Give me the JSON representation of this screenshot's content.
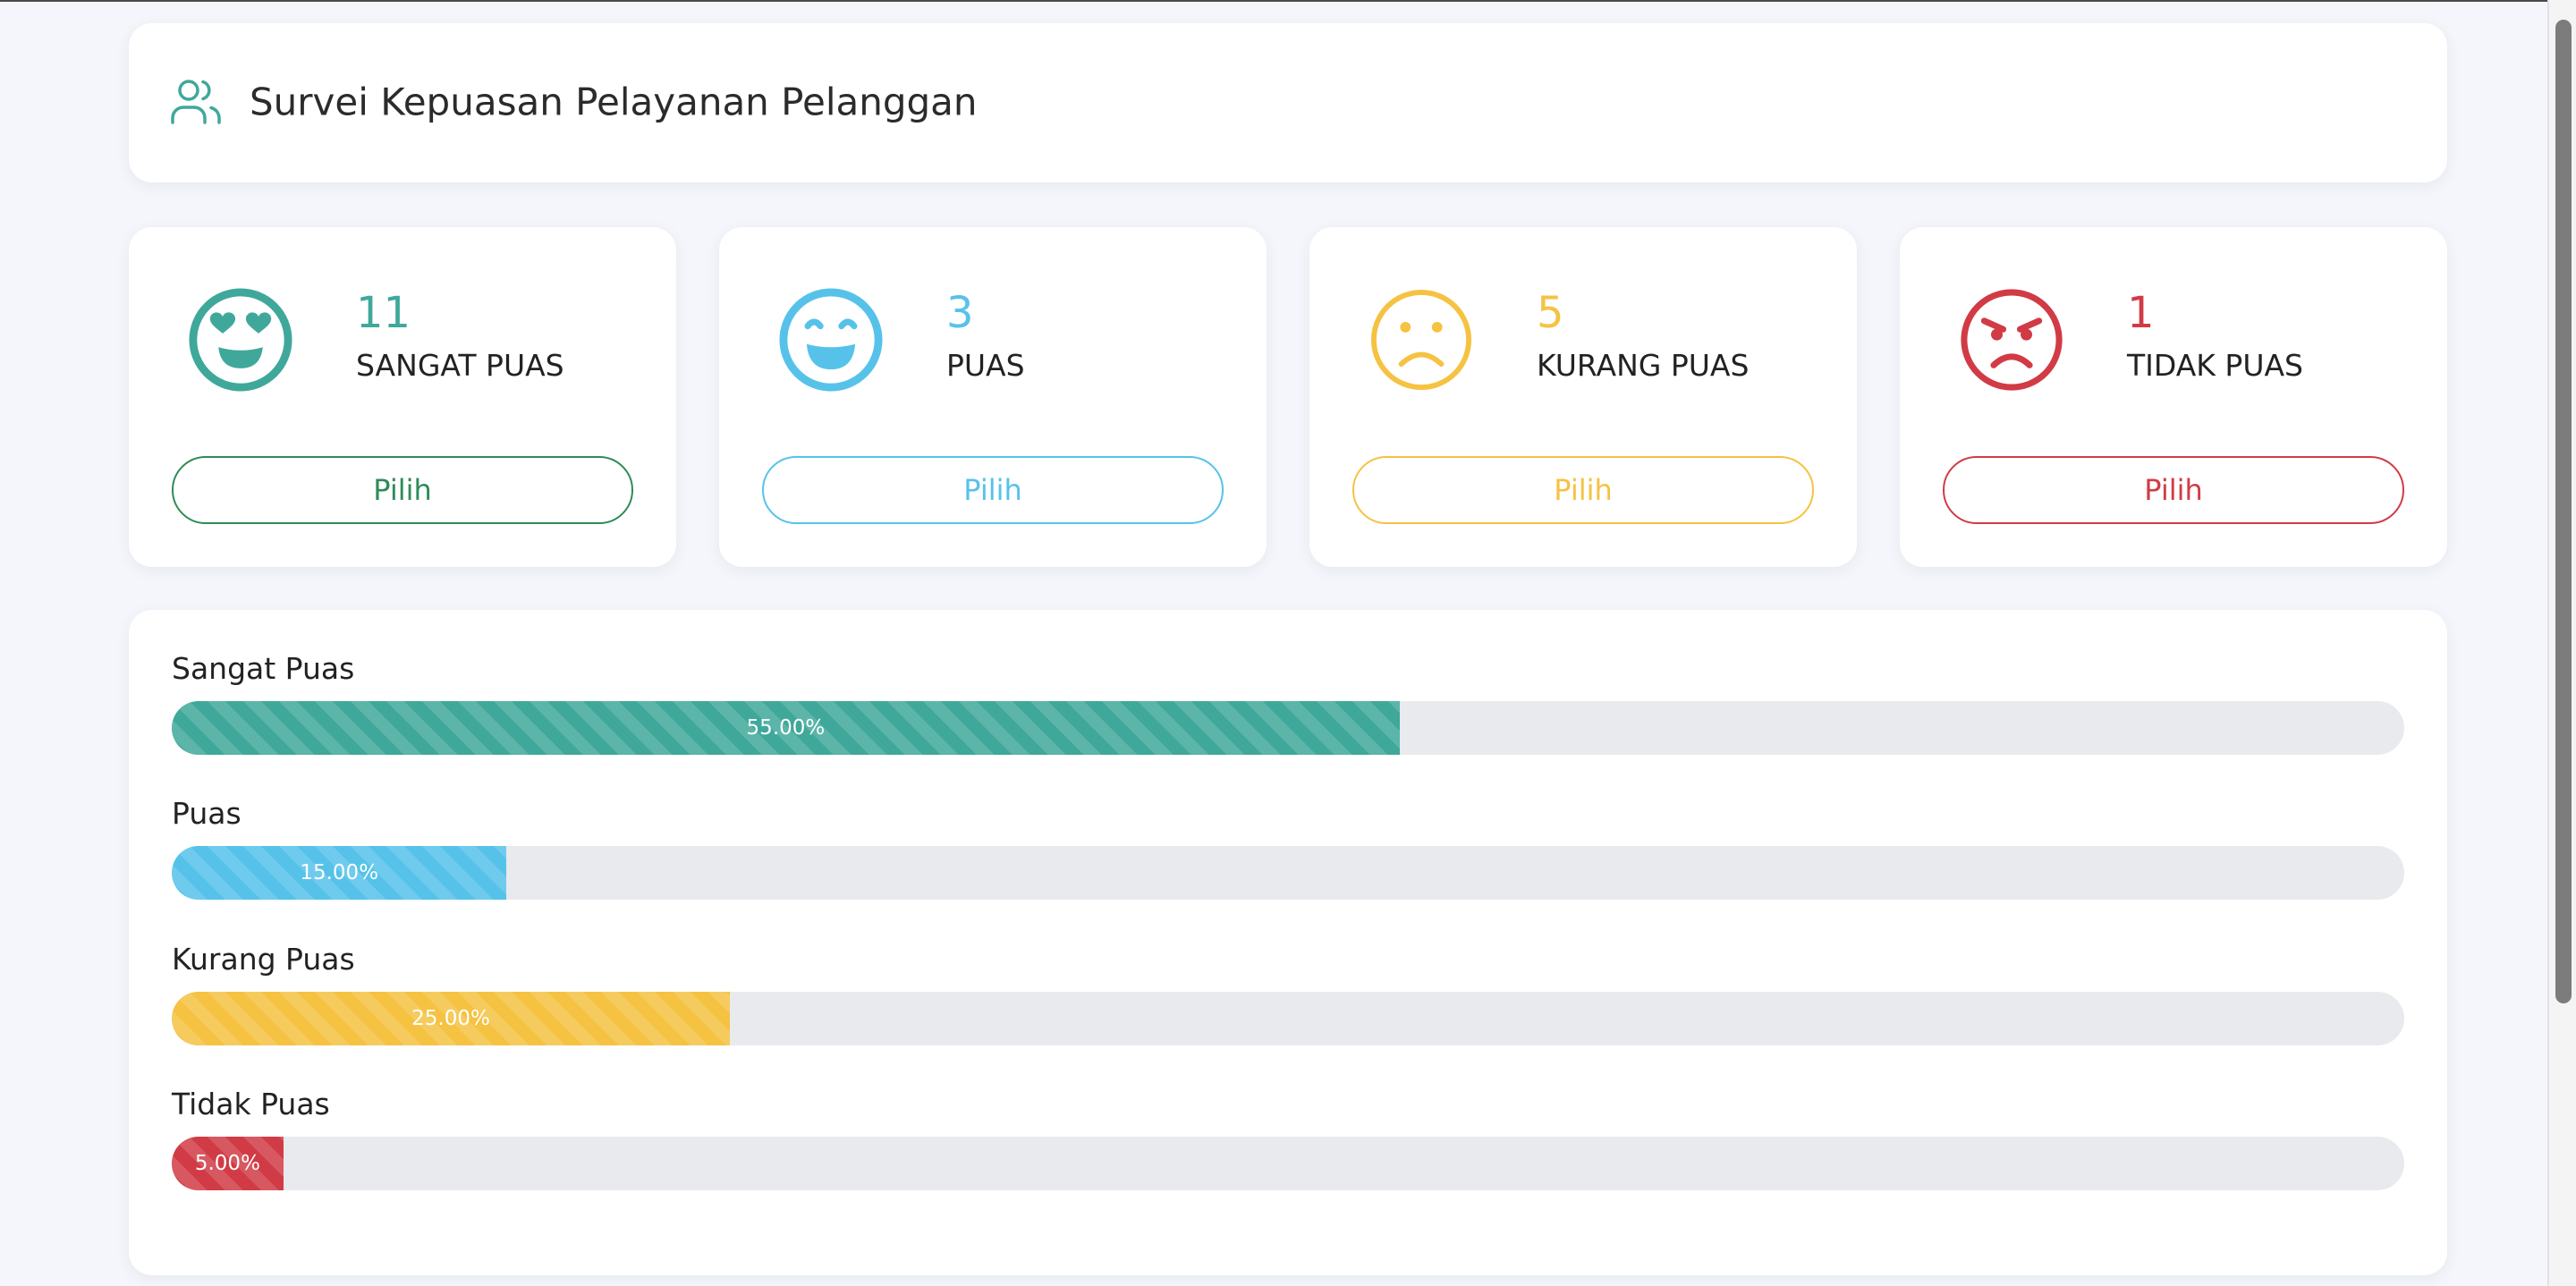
{
  "header": {
    "title": "Survei Kepuasan Pelayanan Pelanggan",
    "icon": "users-icon",
    "icon_color": "#3fa89a"
  },
  "ratings": [
    {
      "key": "sangat-puas",
      "count": "11",
      "label": "SANGAT PUAS",
      "button_label": "Pilih",
      "color": "#3fa89a",
      "button_border": "#2e8b57",
      "button_text": "#2e8b57",
      "icon": "heart-eyes-face-icon"
    },
    {
      "key": "puas",
      "count": "3",
      "label": "PUAS",
      "button_label": "Pilih",
      "color": "#56c2ea",
      "button_border": "#56c2ea",
      "button_text": "#56c2ea",
      "icon": "grinning-face-icon"
    },
    {
      "key": "kurang-puas",
      "count": "5",
      "label": "KURANG PUAS",
      "button_label": "Pilih",
      "color": "#f5c242",
      "button_border": "#f5c242",
      "button_text": "#f5c242",
      "icon": "frowning-face-icon"
    },
    {
      "key": "tidak-puas",
      "count": "1",
      "label": "TIDAK PUAS",
      "button_label": "Pilih",
      "color": "#d13b45",
      "button_border": "#d13b45",
      "button_text": "#d13b45",
      "icon": "angry-face-icon"
    }
  ],
  "progress": [
    {
      "label": "Sangat Puas",
      "percent": 55.0,
      "text": "55.00%",
      "color": "#3fa89a"
    },
    {
      "label": "Puas",
      "percent": 15.0,
      "text": "15.00%",
      "color": "#56c2ea"
    },
    {
      "label": "Kurang Puas",
      "percent": 25.0,
      "text": "25.00%",
      "color": "#f5c242"
    },
    {
      "label": "Tidak Puas",
      "percent": 5.0,
      "text": "5.00%",
      "color": "#d13b45"
    }
  ]
}
